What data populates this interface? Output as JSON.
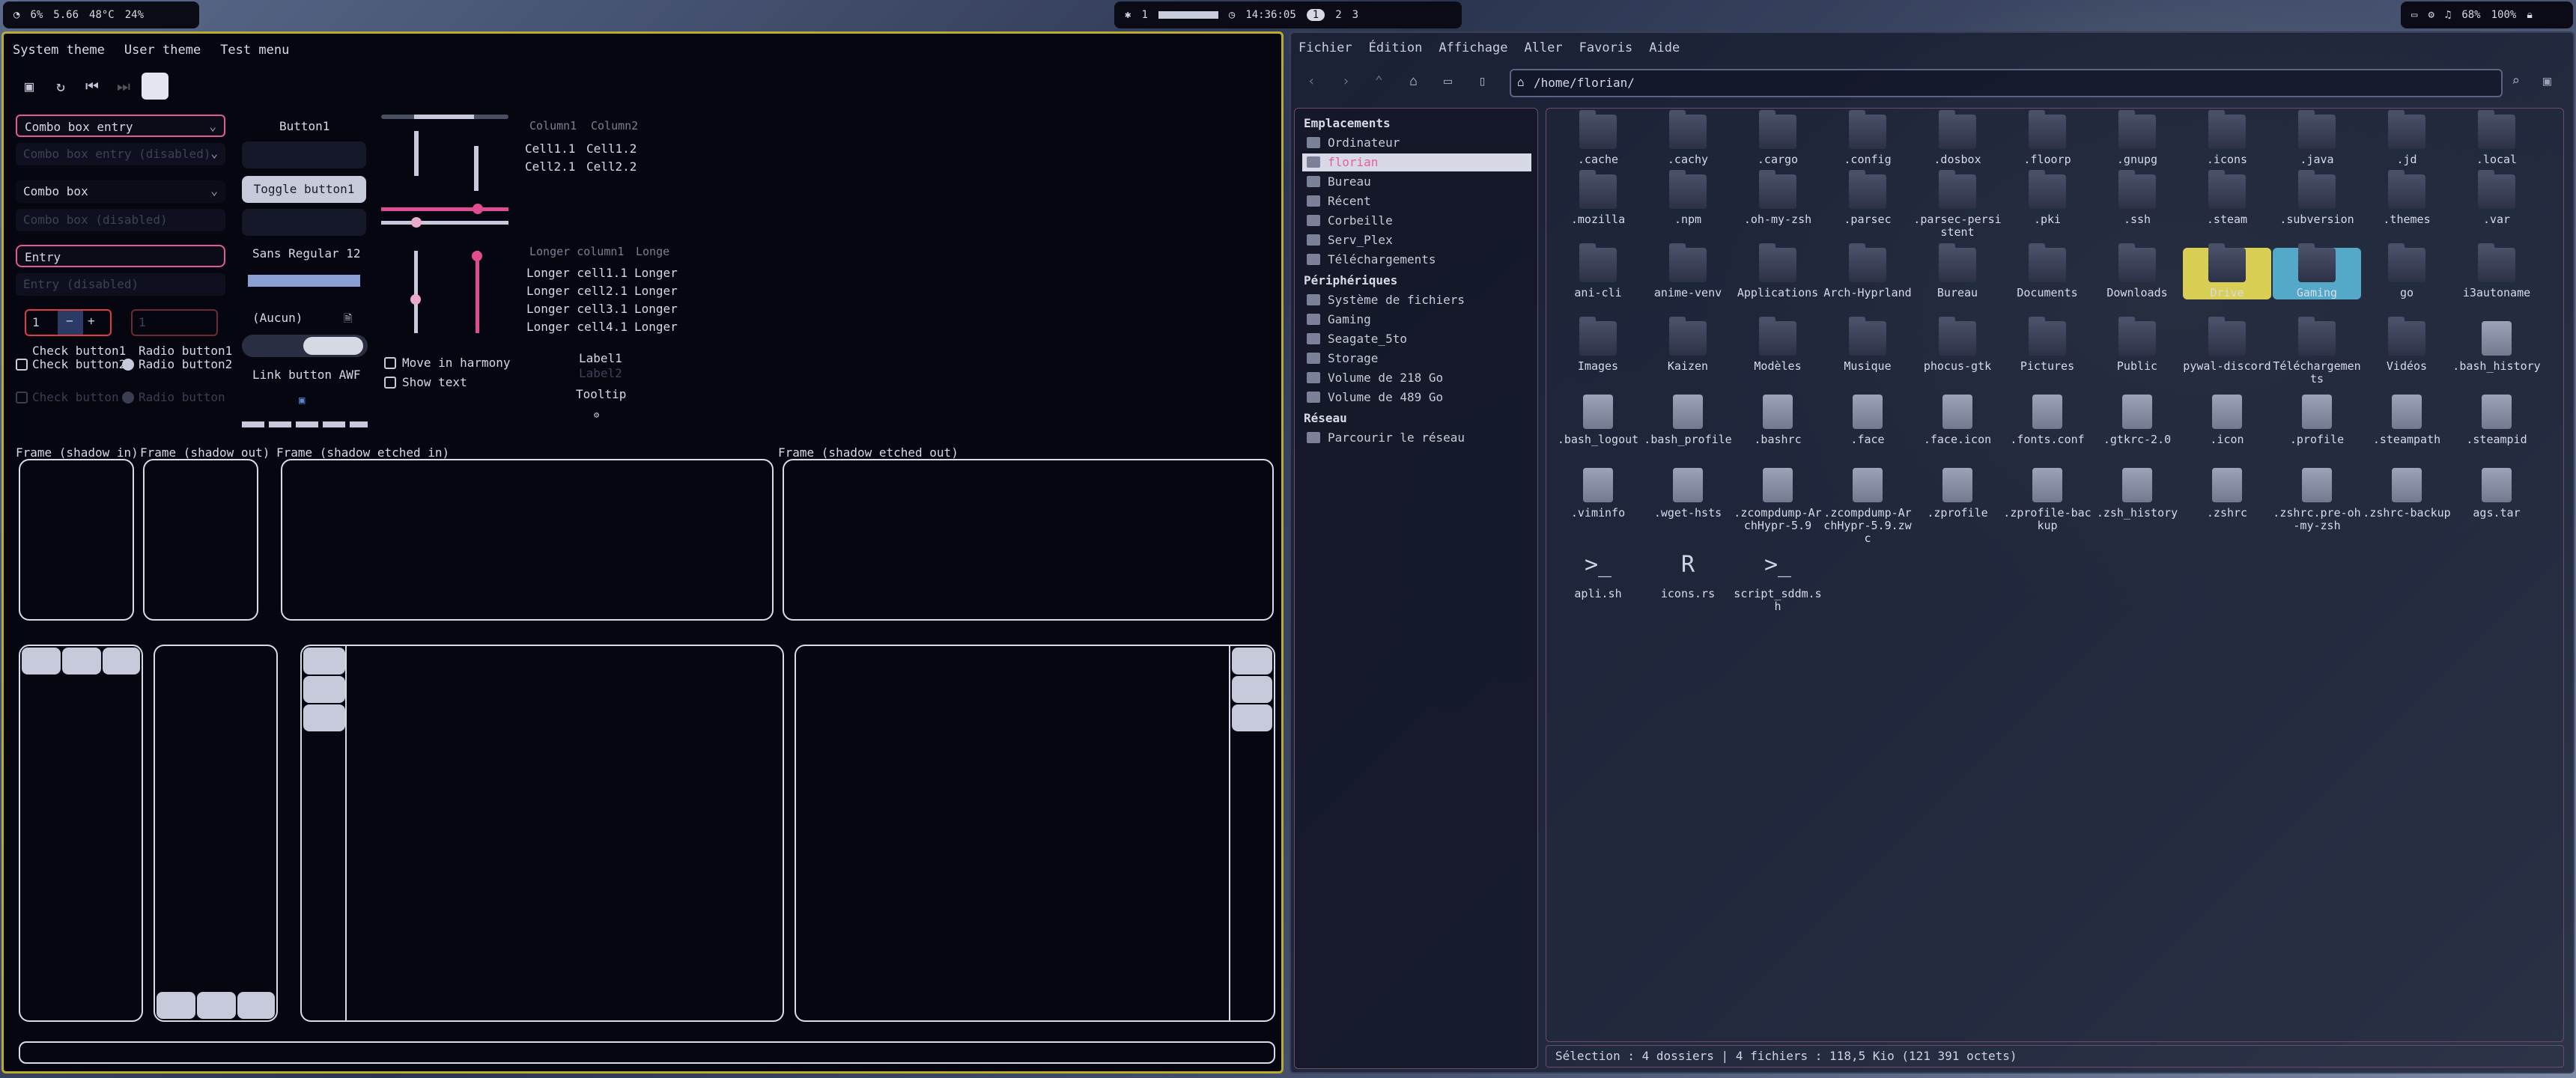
{
  "waybar": {
    "left": {
      "cpu": "6%",
      "load": "5.66",
      "temp": "48°C",
      "vol": "24%"
    },
    "center": {
      "workspace": "1",
      "clock": "14:36:05",
      "ws": [
        "1",
        "2",
        "3"
      ]
    },
    "right": {
      "audio": "68%",
      "battery": "100%"
    }
  },
  "gtk": {
    "menu": [
      "System theme",
      "User theme",
      "Test menu"
    ],
    "combo_entry": "Combo box entry",
    "combo_entry_dis": "Combo box entry (disabled)",
    "combo": "Combo box",
    "combo_dis": "Combo box (disabled)",
    "entry": "Entry",
    "entry_dis": "Entry (disabled)",
    "spin": "1",
    "spin2": "1",
    "check1": "Check button1",
    "check2": "Check button2",
    "check_dis": "Check button",
    "radio1": "Radio button1",
    "radio2": "Radio button2",
    "radio_dis": "Radio button",
    "button1": "Button1",
    "toggle1": "Toggle button1",
    "font": "Sans Regular 12",
    "none": "(Aucun)",
    "link": "Link button AWF",
    "move_harmony": "Move in harmony",
    "show_text": "Show text",
    "col1": "Column1",
    "col2": "Column2",
    "cell11": "Cell1.1",
    "cell12": "Cell1.2",
    "cell21": "Cell2.1",
    "cell22": "Cell2.2",
    "lcol1": "Longer column1",
    "lcol2": "Longe",
    "lrows": [
      [
        "Longer cell1.1",
        "Longer"
      ],
      [
        "Longer cell2.1",
        "Longer"
      ],
      [
        "Longer cell3.1",
        "Longer"
      ],
      [
        "Longer cell4.1",
        "Longer"
      ]
    ],
    "label1": "Label1",
    "label2": "Label2",
    "tooltip": "Tooltip",
    "frames": [
      "Frame (shadow in)",
      "Frame (shadow out)",
      "Frame (shadow etched in)",
      "Frame (shadow etched out)"
    ]
  },
  "fm": {
    "menu": [
      "Fichier",
      "Édition",
      "Affichage",
      "Aller",
      "Favoris",
      "Aide"
    ],
    "path": "/home/florian/",
    "sidebar": {
      "places_header": "Emplacements",
      "places": [
        "Ordinateur",
        "florian",
        "Bureau",
        "Récent",
        "Corbeille",
        "Serv_Plex",
        "Téléchargements"
      ],
      "devices_header": "Périphériques",
      "devices": [
        "Système de fichiers",
        "Gaming",
        "Seagate_5to",
        "Storage",
        "Volume de 218 Go",
        "Volume de 489 Go"
      ],
      "network_header": "Réseau",
      "network": [
        "Parcourir le réseau"
      ]
    },
    "files": [
      [
        ".cache",
        ".cachy",
        ".cargo",
        ".config",
        ".dosbox",
        ".floorp",
        ".gnupg",
        ".icons",
        ".java",
        ".jd",
        ".local"
      ],
      [
        ".mozilla",
        ".npm",
        ".oh-my-zsh",
        ".parsec",
        ".parsec-persistent",
        ".pki",
        ".ssh",
        ".steam",
        ".subversion",
        ".themes",
        ".var"
      ],
      [
        "ani-cli",
        "anime-venv",
        "Applications",
        "Arch-Hyprland",
        "Bureau",
        "Documents",
        "Downloads",
        "Drive",
        "Gaming",
        "go",
        "i3autoname"
      ],
      [
        "Images",
        "Kaizen",
        "Modèles",
        "Musique",
        "phocus-gtk",
        "Pictures",
        "Public",
        "pywal-discord",
        "Téléchargements",
        "Vidéos",
        ".bash_history"
      ],
      [
        ".bash_logout",
        ".bash_profile",
        ".bashrc",
        ".face",
        ".face.icon",
        ".fonts.conf",
        ".gtkrc-2.0",
        ".icon",
        ".profile",
        ".steampath",
        ".steampid"
      ],
      [
        ".viminfo",
        ".wget-hsts",
        ".zcompdump-ArchHypr-5.9",
        ".zcompdump-ArchHypr-5.9.zwc",
        ".zprofile",
        ".zprofile-backup",
        ".zsh_history",
        ".zshrc",
        ".zshrc.pre-oh-my-zsh",
        ".zshrc-backup",
        "ags.tar"
      ],
      [
        "apli.sh",
        "icons.rs",
        "script_sddm.sh"
      ]
    ],
    "status": "Sélection : 4 dossiers  |  4 fichiers : 118,5 Kio (121 391 octets)"
  }
}
